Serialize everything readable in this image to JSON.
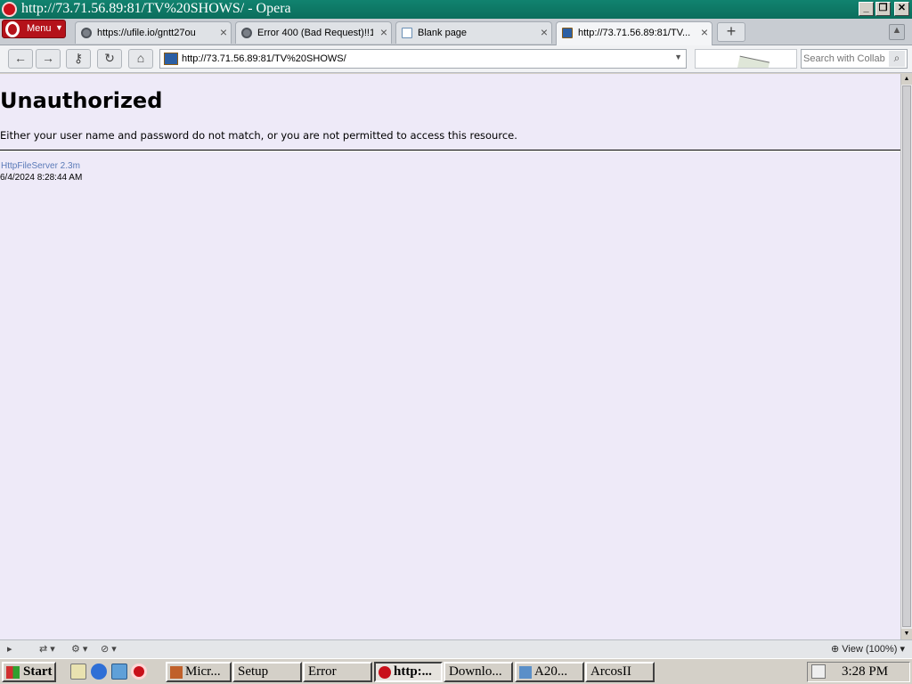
{
  "window": {
    "title": "http://73.71.56.89:81/TV%20SHOWS/ - Opera",
    "controls": {
      "minimize": "_",
      "restore": "❐",
      "close": "✕"
    }
  },
  "tabbar": {
    "menu_label": "Menu",
    "tabs": [
      {
        "label": "https://ufile.io/gntt27ou",
        "icon": "globe-icon"
      },
      {
        "label": "Error 400 (Bad Request)!!1",
        "icon": "globe-icon"
      },
      {
        "label": "Blank page",
        "icon": "page-icon"
      },
      {
        "label": "http://73.71.56.89:81/TV...",
        "icon": "hfs-icon",
        "active": true
      }
    ]
  },
  "navbar": {
    "address": "http://73.71.56.89:81/TV%20SHOWS/",
    "search_placeholder": "Search with Collab"
  },
  "page": {
    "heading": "Unauthorized",
    "message": "Either your user name and password do not match, or you are not permitted to access this resource.",
    "server_link": "HttpFileServer 2.3m",
    "timestamp": "6/4/2024 8:28:44 AM",
    "background": "#eeeaf8"
  },
  "statusbar": {
    "zoom": "View (100%)"
  },
  "taskbar": {
    "start_label": "Start",
    "tasks": [
      {
        "label": "Micr...",
        "icon": "app-icon"
      },
      {
        "label": "Setup"
      },
      {
        "label": "Error"
      },
      {
        "label": "http:...",
        "icon": "opera-icon",
        "active": true
      },
      {
        "label": "Downlo..."
      },
      {
        "label": "A20...",
        "icon": "app-icon"
      },
      {
        "label": "ArcosII"
      }
    ],
    "clock": "3:28 PM"
  },
  "colors": {
    "titlebar": "#0b6e5c",
    "opera_red": "#b4121a",
    "link": "#5a7ab8"
  }
}
